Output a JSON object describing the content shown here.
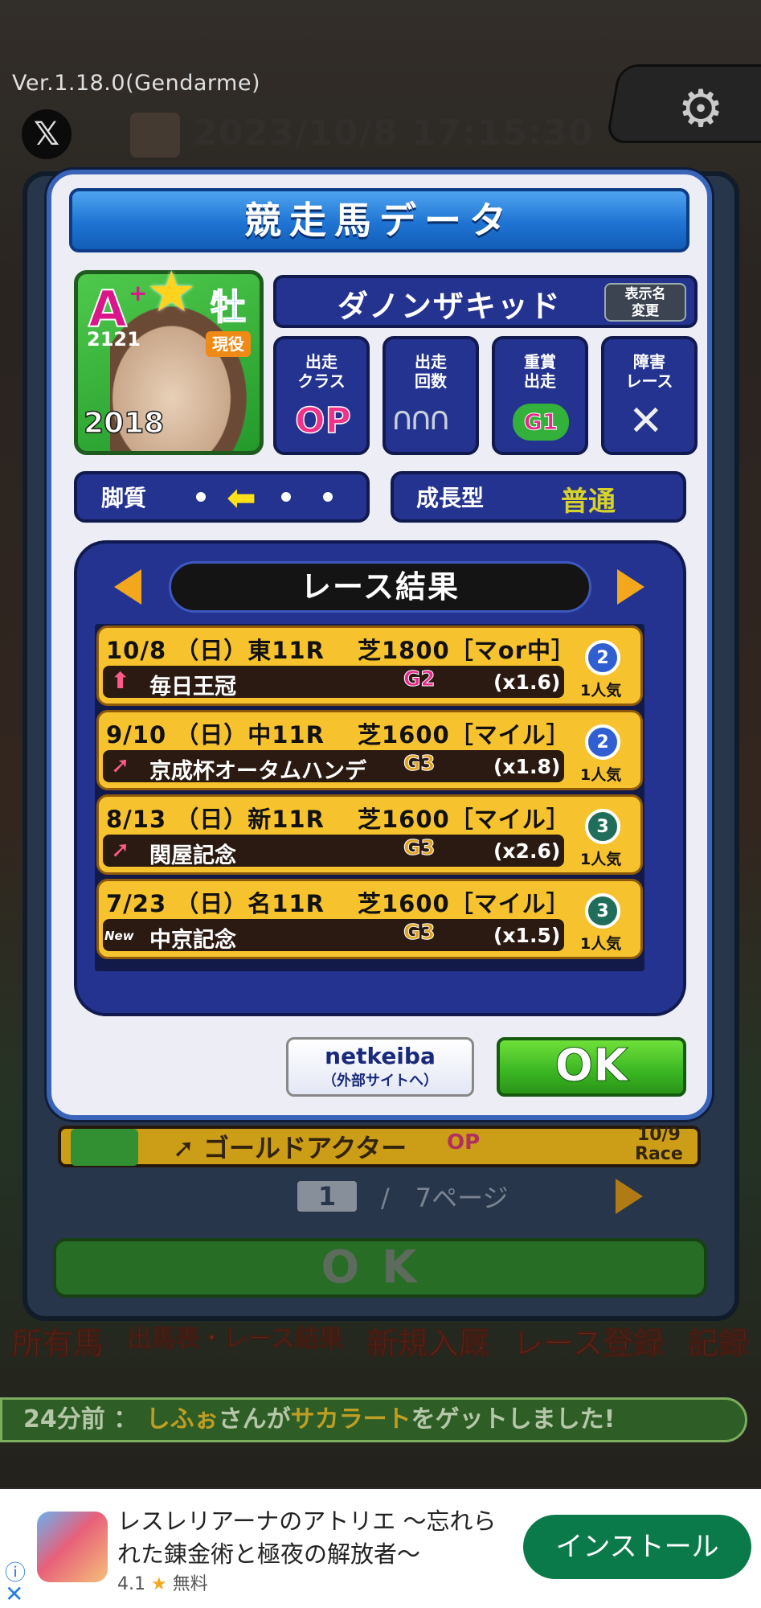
{
  "app": {
    "version": "Ver.1.18.0(Gendarme)",
    "datetime": "2023/10/8 17:15:30"
  },
  "modal": {
    "title": "競走馬データ",
    "horse": {
      "grade": "A",
      "grade_plus": "+",
      "sex": "牡",
      "rating": "2121",
      "status": "現役",
      "year": "2018",
      "name": "ダノンザキッド",
      "rename_label_1": "表示名",
      "rename_label_2": "変更"
    },
    "stats": {
      "class_label_1": "出走",
      "class_label_2": "クラス",
      "class_value": "OP",
      "count_label_1": "出走",
      "count_label_2": "回数",
      "graded_label_1": "重賞",
      "graded_label_2": "出走",
      "graded_value": "G1",
      "hurdle_label_1": "障害",
      "hurdle_label_2": "レース",
      "hurdle_value": "✕"
    },
    "running_style_label": "脚質",
    "growth_label": "成長型",
    "growth_value": "普通",
    "results_title": "レース結果",
    "races": [
      {
        "info": "10/8 （日）東11R　 芝1800［マor中］",
        "name": "毎日王冠",
        "grade": "G2",
        "grade_color": "#e8288a",
        "odds": "(x1.6)",
        "popularity": "1人気",
        "rank": "2",
        "trend": "⬆",
        "medal_color": "#2f5fd0"
      },
      {
        "info": "9/10 （日）中11R　 芝1600［マイル］",
        "name": "京成杯オータムハンデ",
        "grade": "G3",
        "grade_color": "#e0a11a",
        "odds": "(x1.8)",
        "popularity": "1人気",
        "rank": "2",
        "trend": "➚",
        "medal_color": "#2f5fd0"
      },
      {
        "info": "8/13 （日）新11R　 芝1600［マイル］",
        "name": "関屋記念",
        "grade": "G3",
        "grade_color": "#e0a11a",
        "odds": "(x2.6)",
        "popularity": "1人気",
        "rank": "3",
        "trend": "➚",
        "medal_color": "#1f6d5a"
      },
      {
        "info": "7/23 （日）名11R　 芝1600［マイル］",
        "name": "中京記念",
        "grade": "G3",
        "grade_color": "#e0a11a",
        "odds": "(x1.5)",
        "popularity": "1人気",
        "rank": "3",
        "trend": "New",
        "medal_color": "#1f6d5a"
      }
    ],
    "netkeiba_label": "netkeiba",
    "netkeiba_sub": "（外部サイトへ）",
    "ok_label": "OK"
  },
  "background": {
    "row_name": "ゴールドアクター",
    "row_class": "OP",
    "row_date_1": "10/9",
    "row_date_2": "Race",
    "page_current": "1",
    "page_total": "/　7ページ",
    "ok_label": "OK",
    "nav": [
      "所有馬",
      "出馬表・レース結果",
      "新規入厩",
      "レース登録",
      "記録"
    ],
    "ticker_time": "24分前 ：",
    "ticker_user": "しふぉ",
    "ticker_mid": "さんが",
    "ticker_item": "サカラート",
    "ticker_end": "をゲットしました!"
  },
  "ad": {
    "title": "レスレリアーナのアトリエ 〜忘れられた錬金術と極夜の解放者〜",
    "rating": "4.1",
    "price": "無料",
    "install_label": "インストール"
  }
}
